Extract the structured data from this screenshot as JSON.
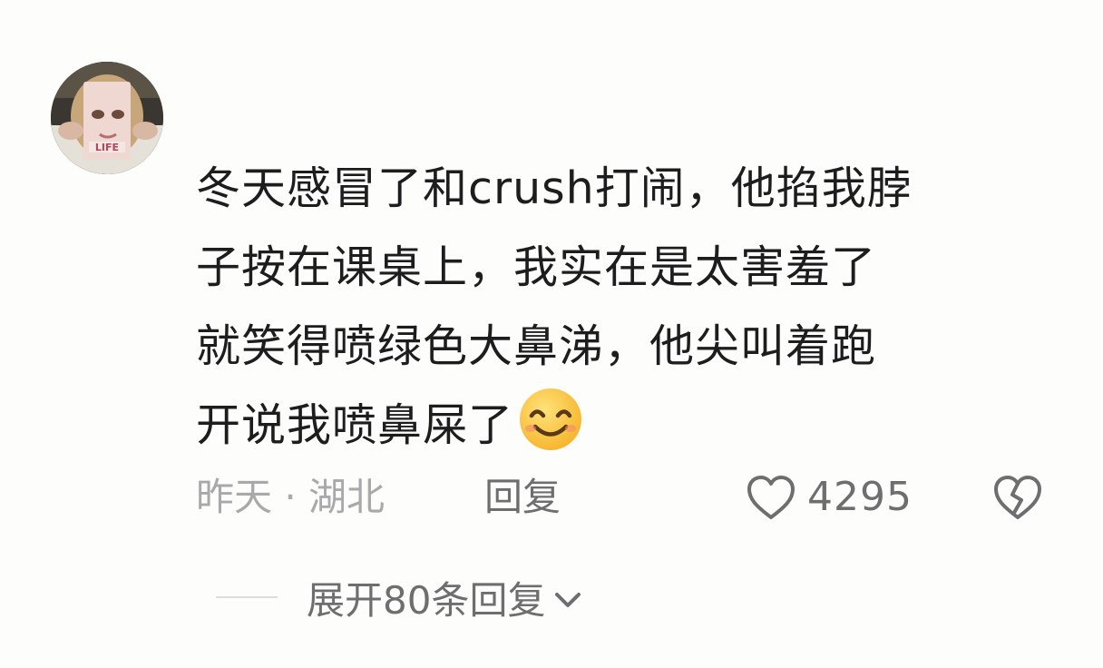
{
  "comment": {
    "avatar_icon": "user-avatar",
    "text_lines": [
      "冬天感冒了和crush打闹，他掐我脖",
      "子按在课桌上，我实在是太害羞了",
      "就笑得喷绿色大鼻涕，他尖叫着跑",
      "开说我喷鼻屎了"
    ],
    "emoji_icon": "smiling-face-emoji",
    "time_location": "昨天 · 湖北",
    "reply_label": "回复",
    "like_icon": "heart-outline-icon",
    "like_count": "4295",
    "dislike_icon": "broken-heart-icon",
    "expand_replies_label": "展开80条回复",
    "expand_icon": "chevron-down-icon"
  },
  "colors": {
    "background": "#fdfdfc",
    "text_primary": "#1d1d1d",
    "text_secondary": "#a9a9a9",
    "text_action": "#6e6e6e"
  }
}
